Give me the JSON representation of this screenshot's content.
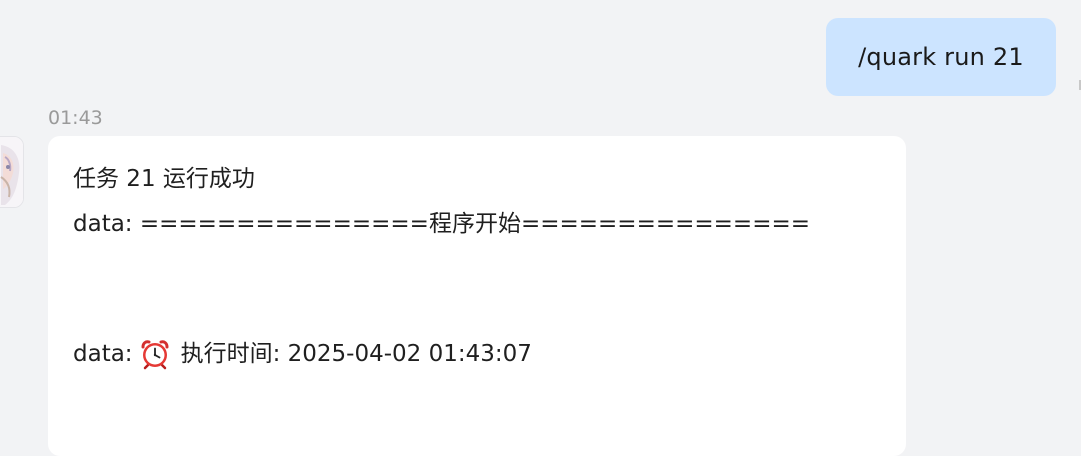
{
  "outgoing": {
    "text": "/quark run 21"
  },
  "incoming": {
    "time": "01:43",
    "lines": [
      "任务 21 运行成功",
      "data: ===============程序开始===============",
      "data: ",
      "执行时间: 2025-04-02 01:43:07"
    ],
    "icon": "alarm-clock-icon"
  }
}
